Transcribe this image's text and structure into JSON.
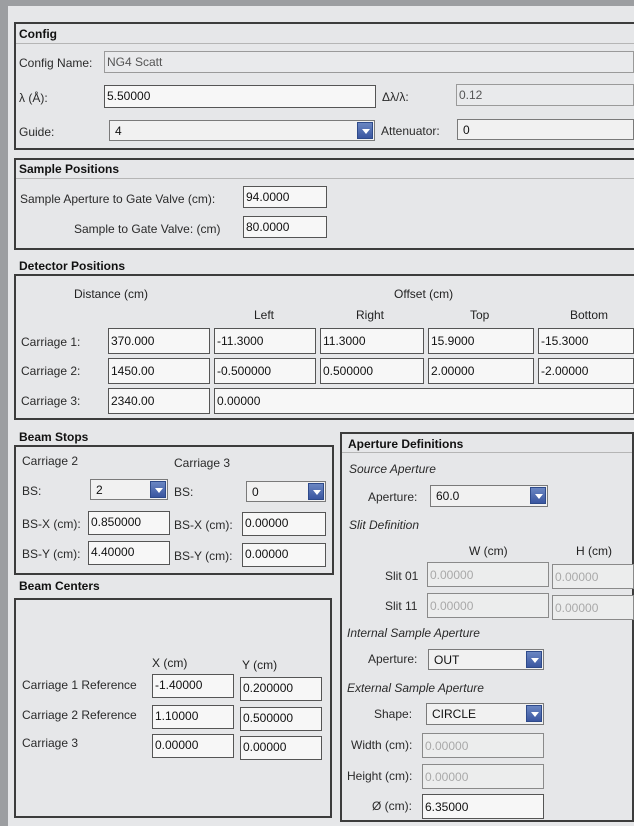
{
  "config": {
    "title": "Config",
    "name_label": "Config Name:",
    "name_value": "NG4 Scatt",
    "lambda_label": "λ (Å):",
    "lambda_value": "5.50000",
    "dlambda_label": "Δλ/λ:",
    "dlambda_value": "0.12",
    "guide_label": "Guide:",
    "guide_value": "4",
    "attenuator_label": "Attenuator:",
    "attenuator_value": "0"
  },
  "sample_positions": {
    "title": "Sample Positions",
    "aperture_label": "Sample Aperture to Gate Valve (cm):",
    "aperture_value": "94.0000",
    "sample_label": "Sample to Gate Valve: (cm)",
    "sample_value": "80.0000"
  },
  "detector_positions": {
    "title": "Detector Positions",
    "distance_header": "Distance (cm)",
    "offset_header": "Offset (cm)",
    "columns": [
      "Left",
      "Right",
      "Top",
      "Bottom"
    ],
    "rows": [
      {
        "label": "Carriage 1:",
        "distance": "370.000",
        "left": "-11.3000",
        "right": "11.3000",
        "top": "15.9000",
        "bottom": "-15.3000"
      },
      {
        "label": "Carriage 2:",
        "distance": "1450.00",
        "left": "-0.500000",
        "right": "0.500000",
        "top": "2.00000",
        "bottom": "-2.00000"
      },
      {
        "label": "Carriage 3:",
        "distance": "2340.00",
        "offset": "0.00000"
      }
    ]
  },
  "beam_stops": {
    "title": "Beam Stops",
    "carriage2_header": "Carriage 2",
    "carriage3_header": "Carriage 3",
    "bs_label": "BS:",
    "bsx_label": "BS-X (cm):",
    "bsy_label": "BS-Y (cm):",
    "c2": {
      "bs": "2",
      "bsx": "0.850000",
      "bsy": "4.40000"
    },
    "c3": {
      "bs": "0",
      "bsx": "0.00000",
      "bsy": "0.00000"
    }
  },
  "beam_centers": {
    "title": "Beam Centers",
    "x_header": "X (cm)",
    "y_header": "Y (cm)",
    "rows": [
      {
        "label": "Carriage 1 Reference",
        "x": "-1.40000",
        "y": "0.200000"
      },
      {
        "label": "Carriage 2 Reference",
        "x": "1.10000",
        "y": "0.500000"
      },
      {
        "label": "Carriage 3",
        "x": "0.00000",
        "y": "0.00000"
      }
    ]
  },
  "aperture_definitions": {
    "title": "Aperture Definitions",
    "source_aperture_header": "Source Aperture",
    "aperture_label": "Aperture:",
    "source_aperture_value": "60.0",
    "slit_definition_header": "Slit Definition",
    "w_header": "W (cm)",
    "h_header": "H (cm)",
    "slit01_label": "Slit 01",
    "slit01_w": "0.00000",
    "slit01_h": "0.00000",
    "slit11_label": "Slit 11",
    "slit11_w": "0.00000",
    "slit11_h": "0.00000",
    "internal_header": "Internal Sample Aperture",
    "internal_aperture_value": "OUT",
    "external_header": "External Sample Aperture",
    "shape_label": "Shape:",
    "shape_value": "CIRCLE",
    "width_label": "Width (cm):",
    "width_value": "0.00000",
    "height_label": "Height (cm):",
    "height_value": "0.00000",
    "diameter_label": "Ø (cm):",
    "diameter_value": "6.35000"
  }
}
